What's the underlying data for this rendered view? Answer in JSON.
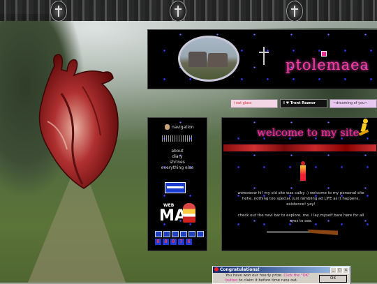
{
  "header": {
    "site_title": "ptolemaea"
  },
  "buttons": [
    {
      "label": "i eat glass"
    },
    {
      "label": "I ♥ Trent Reznor"
    },
    {
      "label": "~dreaming of you~"
    },
    {
      "label": "♦"
    }
  ],
  "nav": {
    "heading": "navigation",
    "links": [
      "about",
      "diary",
      "shrines",
      "everything else"
    ],
    "webmaster_top": "WEB",
    "webmaster_big": "MA",
    "counter": [
      "0",
      "0",
      "0",
      "7",
      "6"
    ]
  },
  "main": {
    "welcome": "welcome to my site",
    "intro": "wowowow hi! my old site was calby :) welcome to my personal site hehe. nothing too special, just rambling ad LIFE as it happens. existence! yay!",
    "explore": "check out the navi bar to explore. me. i lay myself bare here for all eyes to see."
  },
  "popup": {
    "title": "Congratulations!",
    "message_pre": "You have won our hourly prize. ",
    "message_hl": "Click the \"OK\" button",
    "message_post": " to claim it before time runs out.",
    "ok_label": "OK",
    "btn_min": "_",
    "btn_max": "□",
    "btn_close": "x"
  }
}
